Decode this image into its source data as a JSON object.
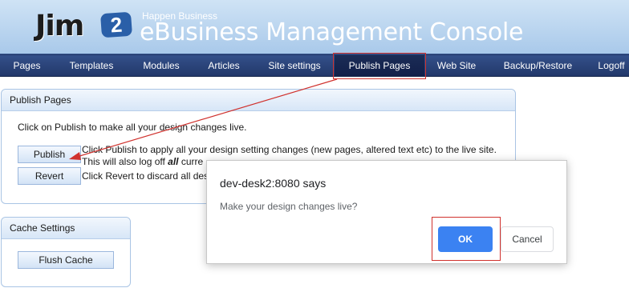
{
  "header": {
    "logo_text": "Jim",
    "logo_badge": "2",
    "tagline": "Happen Business",
    "title": "eBusiness Management Console"
  },
  "nav": {
    "items": [
      {
        "label": "Pages"
      },
      {
        "label": "Templates"
      },
      {
        "label": "Modules"
      },
      {
        "label": "Articles"
      },
      {
        "label": "Site settings"
      },
      {
        "label": "Publish Pages"
      },
      {
        "label": "Web Site"
      },
      {
        "label": "Backup/Restore"
      },
      {
        "label": "Logoff"
      }
    ],
    "active": "Publish Pages"
  },
  "publish_panel": {
    "heading": "Publish Pages",
    "intro": "Click on Publish to make all your design changes live.",
    "publish_button": "Publish",
    "revert_button": "Revert",
    "publish_desc_1": "Click Publish to apply all your design setting changes (new pages, altered text etc) to the live site.",
    "publish_desc_2_prefix": "This will also log off",
    "publish_desc_2_emph": "all",
    "publish_desc_2_suffix": "curre",
    "revert_desc": "Click Revert to discard all des"
  },
  "cache_panel": {
    "heading": "Cache Settings",
    "flush_button": "Flush Cache"
  },
  "dialog": {
    "title": "dev-desk2:8080 says",
    "message": "Make your design changes live?",
    "ok_label": "OK",
    "cancel_label": "Cancel"
  },
  "colors": {
    "nav_bg": "#22386a",
    "annotation_red": "#d0312d",
    "ok_blue": "#3b82f2"
  }
}
